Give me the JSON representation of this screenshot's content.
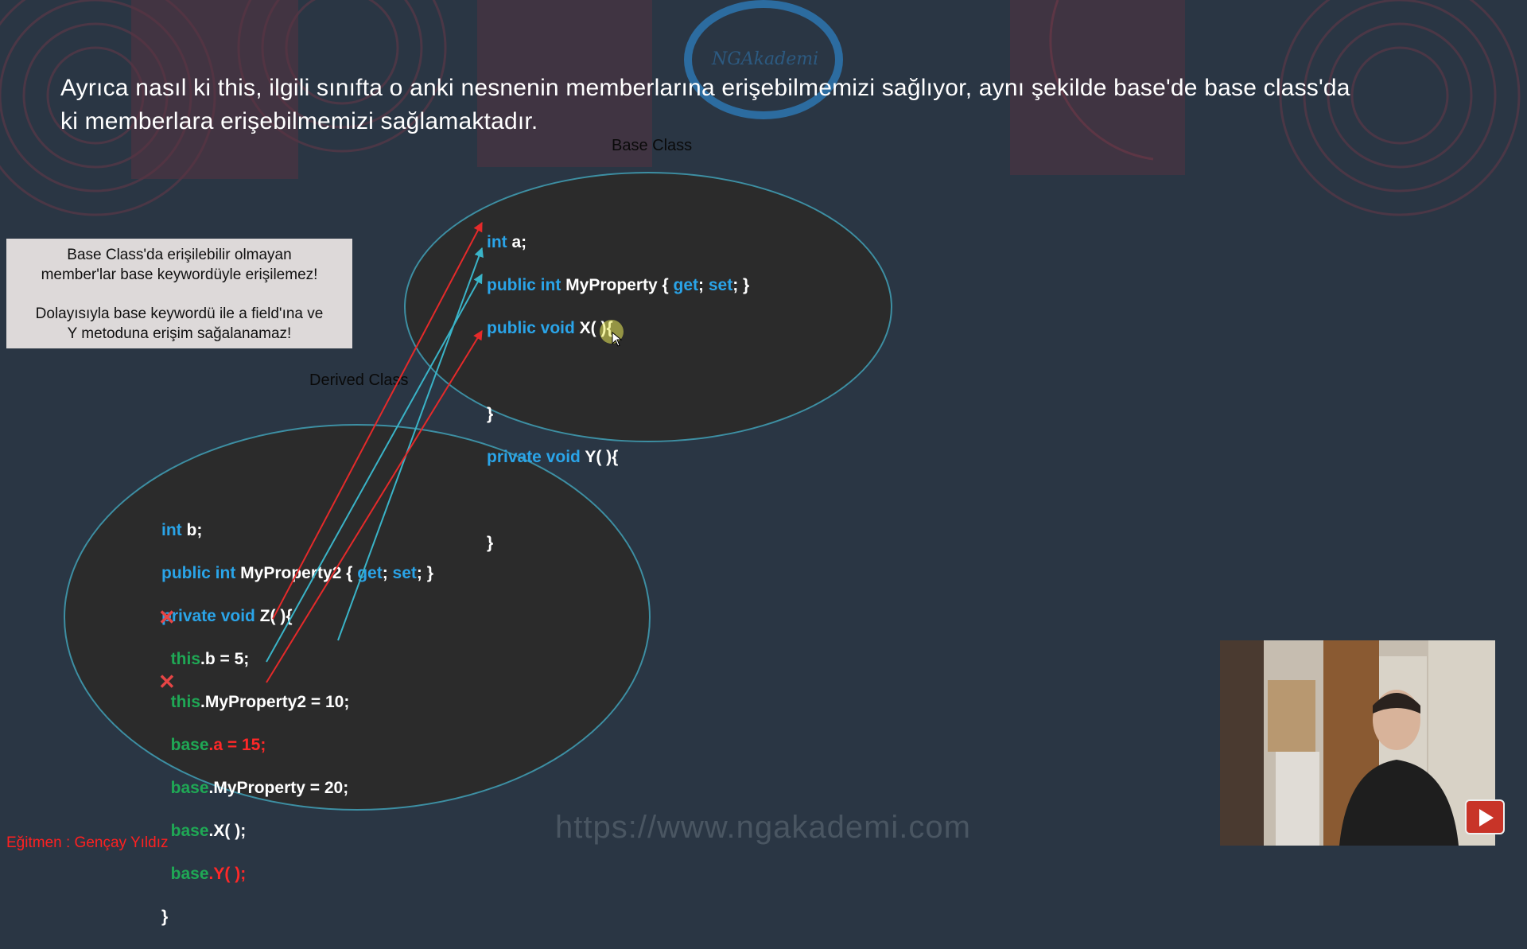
{
  "slide": {
    "paragraph_line1": "Ayrıca nasıl ki this, ilgili sınıfta o anki nesnenin memberlarına erişebilmemizi sağlıyor, aynı şekilde base'de base class'da",
    "paragraph_line2": "ki memberlara erişebilmemizi sağlamaktadır.",
    "base_class_label": "Base Class",
    "derived_class_label": "Derived Class",
    "note_line1": "Base Class'da erişilebilir olmayan",
    "note_line2": "member'lar base keywordüyle erişilemez!",
    "note_line3": "Dolayısıyla base keywordü ile a field'ına ve",
    "note_line4": "Y metoduna erişim sağalanamaz!",
    "watermark_logo": "NGAkademi"
  },
  "base_code": {
    "l1_kw": "int",
    "l1_rest": " a;",
    "l2_kw": "public int",
    "l2_name": " MyProperty { ",
    "l2_get": "get",
    "l2_sep": "; ",
    "l2_set": "set",
    "l2_end": "; }",
    "l3_kw": "public void",
    "l3_rest": " X( ){",
    "l4": "}",
    "l5_kw": "private void",
    "l5_rest": " Y( ){",
    "l6": "}"
  },
  "derived_code": {
    "l1_kw": "int",
    "l1_rest": " b;",
    "l2_kw": "public int",
    "l2_name": " MyProperty2 { ",
    "l2_get": "get",
    "l2_sep": "; ",
    "l2_set": "set",
    "l2_end": "; }",
    "l3_kw": "private void",
    "l3_rest": " Z( ){",
    "l4_this": "this",
    "l4_rest": ".b = 5;",
    "l5_this": "this",
    "l5_rest": ".MyProperty2 = 10;",
    "l6_base": "base",
    "l6_rest": ".a = 15;",
    "l7_base": "base",
    "l7_rest": ".MyProperty = 20;",
    "l8_base": "base",
    "l8_rest": ".X( );",
    "l9_base": "base",
    "l9_rest": ".Y( );",
    "l10": "}"
  },
  "marks": {
    "cross": "✕"
  },
  "footer": {
    "url": "https://www.ngakademi.com",
    "instructor": "Eğitmen : Gençay Yıldız"
  },
  "icons": {
    "youtube": "youtube-play-icon",
    "cursor": "mouse-cursor-icon"
  },
  "colors": {
    "keyword": "#2aa4e8",
    "this_base": "#1fa855",
    "error": "#ff2828",
    "arrow_red": "#e52a2a",
    "arrow_teal": "#3ab4c8"
  }
}
